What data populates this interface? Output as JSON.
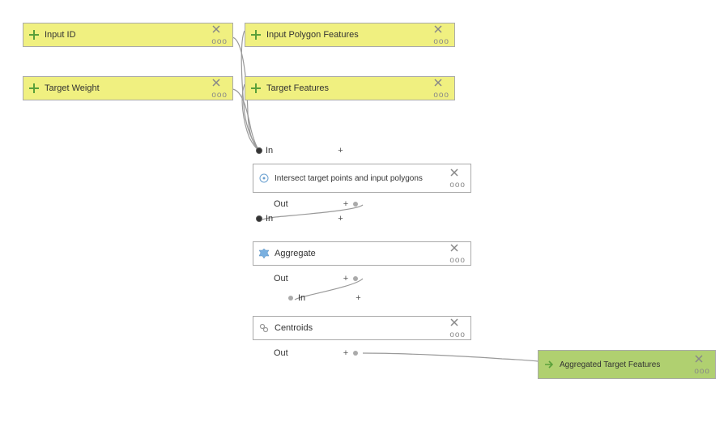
{
  "nodes": {
    "input_id": "Input ID",
    "input_poly": "Input Polygon Features",
    "target_weight": "Target Weight",
    "target_feat": "Target Features",
    "intersect": "Intersect target points and input polygons",
    "aggregate": "Aggregate",
    "centroids": "Centroids",
    "output": "Aggregated Target Features"
  },
  "ports": {
    "in": "In",
    "out": "Out",
    "plus": "+"
  },
  "icons": {
    "plus": "plus-icon",
    "gear": "gear-icon",
    "chain": "chain-icon",
    "arrow": "arrow-icon",
    "close": "close-icon",
    "dots": "ooo"
  },
  "colors": {
    "param": "#f0f080",
    "process": "#ffffff",
    "output": "#b0d070"
  }
}
